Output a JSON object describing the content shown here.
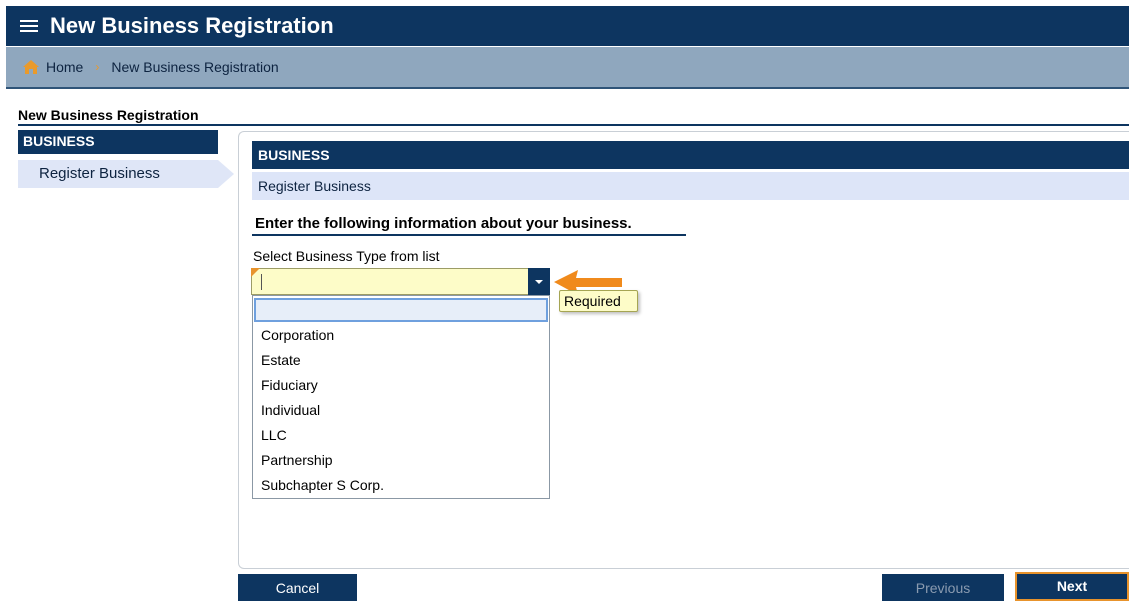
{
  "header": {
    "title": "New Business Registration",
    "menu_icon": "hamburger-menu-icon"
  },
  "breadcrumb": {
    "home_icon": "home-icon",
    "home_label": "Home",
    "separator": "›",
    "current": "New Business Registration"
  },
  "page": {
    "heading": "New Business Registration"
  },
  "sidebar": {
    "section": "BUSINESS",
    "items": [
      {
        "label": "Register Business"
      }
    ]
  },
  "main": {
    "section_title": "BUSINESS",
    "section_subtitle": "Register Business",
    "instruction": "Enter the following information about your business.",
    "field": {
      "label": "Select Business Type from list",
      "value": "",
      "tooltip": "Required"
    },
    "dropdown": {
      "options": [
        "",
        "Corporation",
        "Estate",
        "Fiduciary",
        "Individual",
        "LLC",
        "Partnership",
        "Subchapter S Corp."
      ]
    }
  },
  "buttons": {
    "cancel": "Cancel",
    "previous": "Previous",
    "next": "Next"
  },
  "colors": {
    "navy": "#0d3560",
    "accent_orange": "#e8932c",
    "required_yellow": "#fdfcc8"
  }
}
